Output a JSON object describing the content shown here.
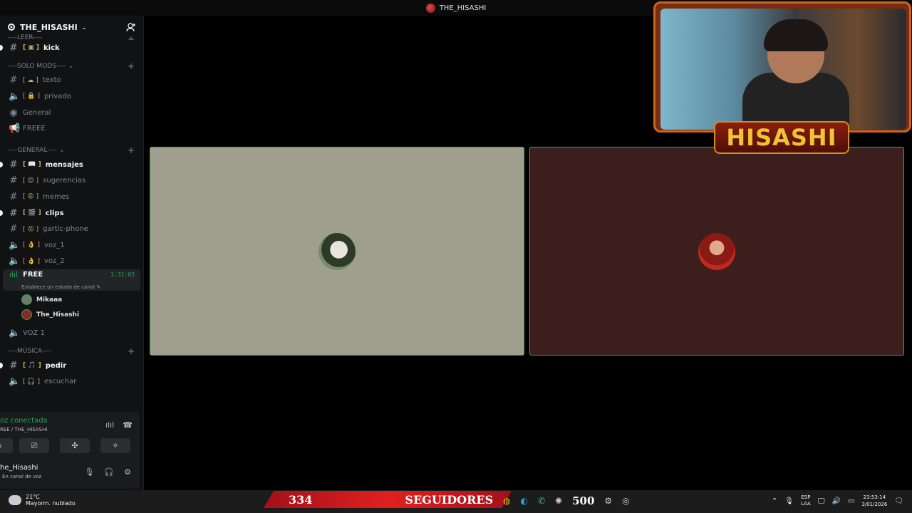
{
  "window": {
    "title": "THE_HISASHI"
  },
  "server": {
    "name": "THE_HISASHI"
  },
  "sidebar": {
    "categories": [
      {
        "label": "----LEER----"
      },
      {
        "label": "----SOLO MODS----"
      },
      {
        "label": "----GENERAL----"
      },
      {
        "label": "----MÚSICA----"
      }
    ],
    "channels": [
      {
        "label": "kick"
      },
      {
        "label": "texto"
      },
      {
        "label": "privado"
      },
      {
        "label": "General"
      },
      {
        "label": "FREEE"
      },
      {
        "label": "mensajes"
      },
      {
        "label": "sugerencias"
      },
      {
        "label": "memes"
      },
      {
        "label": "clips"
      },
      {
        "label": "gartic-phone"
      },
      {
        "label": "voz_1"
      },
      {
        "label": "voz_2"
      },
      {
        "label": "FREE",
        "timer": "1:31:03",
        "status": "Establece un estado de canal"
      },
      {
        "label": "VOZ 1"
      },
      {
        "label": "pedir"
      },
      {
        "label": "escuchar"
      }
    ],
    "members": [
      {
        "name": "Mikaaa"
      },
      {
        "name": "The_Hisashi"
      }
    ]
  },
  "voice_panel": {
    "title": "oz conectada",
    "subtitle": "REE / THE_HISASHI",
    "user": "he_Hisashi",
    "user_status": "En canal de voz"
  },
  "webcam": {
    "banner": "HISASHI"
  },
  "taskbar": {
    "temperature": "21°C",
    "weather": "Mayorm. nublado",
    "followers_count": "334",
    "followers_label": "SEGUIDORES",
    "count_500": "500",
    "lang_1": "ESP",
    "lang_2": "LAA",
    "time": "23:53:14",
    "date": "3/01/2026"
  },
  "colors": {
    "accent_green": "#23a559",
    "tile_left_bg": "#a09e8c",
    "tile_right_bg": "#3c1f1d"
  }
}
